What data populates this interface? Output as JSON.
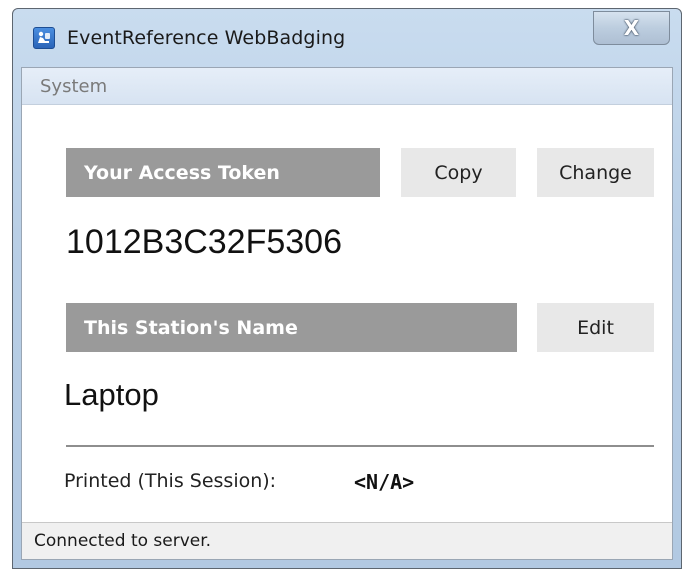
{
  "window": {
    "title": "EventReference WebBadging",
    "close_glyph": "X"
  },
  "menu": {
    "items": [
      "System"
    ]
  },
  "access_token": {
    "header": "Your Access Token",
    "value": "1012B3C32F5306",
    "copy_label": "Copy",
    "change_label": "Change"
  },
  "station": {
    "header": "This Station's Name",
    "value": "Laptop",
    "edit_label": "Edit"
  },
  "printed": {
    "label": "Printed (This Session):",
    "value": "<N/A>"
  },
  "status": {
    "text": "Connected to server."
  },
  "icons": {
    "app": "app-icon",
    "close": "close-icon"
  },
  "colors": {
    "header_bg": "#9a9a9a",
    "button_bg": "#e8e8e8",
    "titlebar": "#b9cfe6"
  }
}
